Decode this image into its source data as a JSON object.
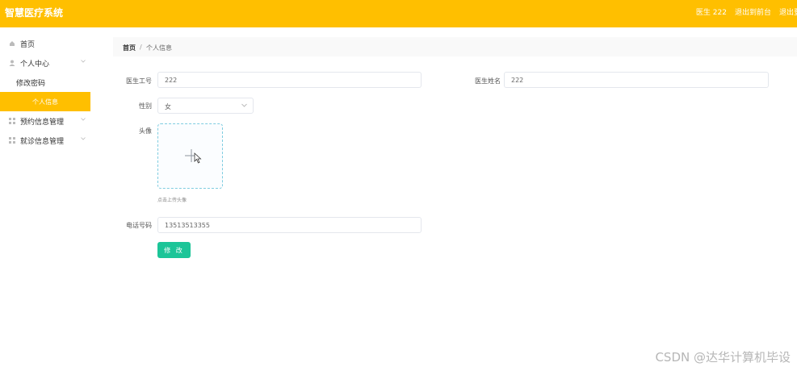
{
  "header": {
    "app_title": "智慧医疗系统",
    "user_label": "医生 222",
    "exit_front": "退出到前台",
    "logout": "退出登录"
  },
  "sidebar": {
    "items": [
      {
        "label": "首页",
        "icon": "home-icon"
      },
      {
        "label": "个人中心",
        "icon": "user-icon"
      },
      {
        "label": "修改密码"
      },
      {
        "label": "个人信息"
      },
      {
        "label": "预约信息管理",
        "icon": "grid-icon"
      },
      {
        "label": "就诊信息管理",
        "icon": "grid-icon"
      }
    ]
  },
  "breadcrumb": {
    "home": "首页",
    "separator": "/",
    "current": "个人信息"
  },
  "form": {
    "doctor_id_label": "医生工号",
    "doctor_id_value": "222",
    "doctor_name_label": "医生姓名",
    "doctor_name_value": "222",
    "gender_label": "性别",
    "gender_value": "女",
    "avatar_label": "头像",
    "avatar_hint": "点击上传头像",
    "phone_label": "电话号码",
    "phone_value": "13513513355",
    "submit_label": "修 改"
  },
  "watermark": "CSDN @达华计算机毕设",
  "colors": {
    "brand": "#ffbf00",
    "submit": "#1cc598",
    "upload_border": "#7fcde0"
  }
}
